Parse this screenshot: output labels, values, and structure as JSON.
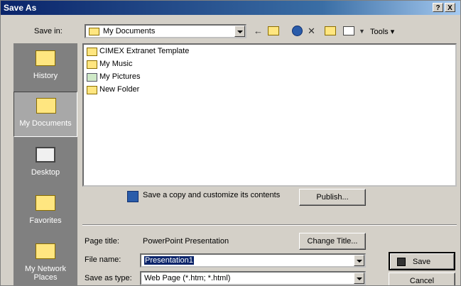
{
  "window": {
    "title": "Save As",
    "help_label": "?",
    "close_label": "X"
  },
  "toolbar": {
    "save_in_label": "Save in:",
    "save_in_value": "My Documents",
    "tools_label": "Tools",
    "icons": [
      "back-icon",
      "up-folder-icon",
      "search-web-icon",
      "delete-icon",
      "new-folder-icon",
      "views-icon"
    ]
  },
  "places": [
    {
      "label": "History",
      "selected": false
    },
    {
      "label": "My Documents",
      "selected": true
    },
    {
      "label": "Desktop",
      "selected": false
    },
    {
      "label": "Favorites",
      "selected": false
    },
    {
      "label": "My Network Places",
      "selected": false
    }
  ],
  "files": [
    {
      "name": "CIMEX Extranet Template",
      "icon": "folder-icon"
    },
    {
      "name": "My Music",
      "icon": "folder-icon"
    },
    {
      "name": "My Pictures",
      "icon": "pictures-folder-icon"
    },
    {
      "name": "New Folder",
      "icon": "folder-icon"
    }
  ],
  "publish": {
    "text": "Save a copy and customize its contents",
    "button": "Publish..."
  },
  "page_title": {
    "label": "Page title:",
    "value": "PowerPoint Presentation",
    "button": "Change Title..."
  },
  "file_name": {
    "label": "File name:",
    "value": "Presentation1"
  },
  "save_as_type": {
    "label": "Save as type:",
    "value": "Web Page (*.htm; *.html)"
  },
  "buttons": {
    "save": "Save",
    "cancel": "Cancel"
  },
  "colors": {
    "title_bar": "#0a246a",
    "dialog_bg": "#d4d0c8",
    "places_bg": "#808080",
    "selection": "#0a246a"
  }
}
